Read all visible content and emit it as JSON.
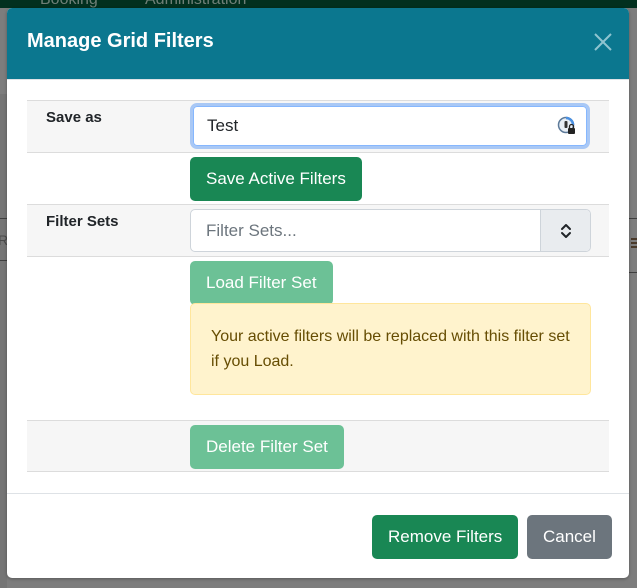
{
  "background": {
    "nav_items": [
      "Booking",
      "Administration"
    ],
    "left_text": "RL",
    "right_icon": "menu-icon"
  },
  "modal": {
    "title": "Manage Grid Filters",
    "close_icon": "close-icon",
    "header_color": "#0b778f",
    "save_as": {
      "label": "Save as",
      "input_value": "Test",
      "input_icon": "password-manager-icon",
      "save_button": "Save Active Filters"
    },
    "filter_sets": {
      "label": "Filter Sets",
      "placeholder": "Filter Sets...",
      "toggle_icon": "chevron-up-down-icon",
      "load_button": "Load Filter Set",
      "warning": "Your active filters will be replaced with this filter set if you Load.",
      "delete_button": "Delete Filter Set"
    },
    "footer": {
      "remove_button": "Remove Filters",
      "cancel_button": "Cancel"
    },
    "colors": {
      "success": "#198754",
      "success_disabled": "#6cc196",
      "secondary": "#6c757d",
      "warning_bg": "#fff3cd",
      "warning_text": "#664d03"
    }
  }
}
